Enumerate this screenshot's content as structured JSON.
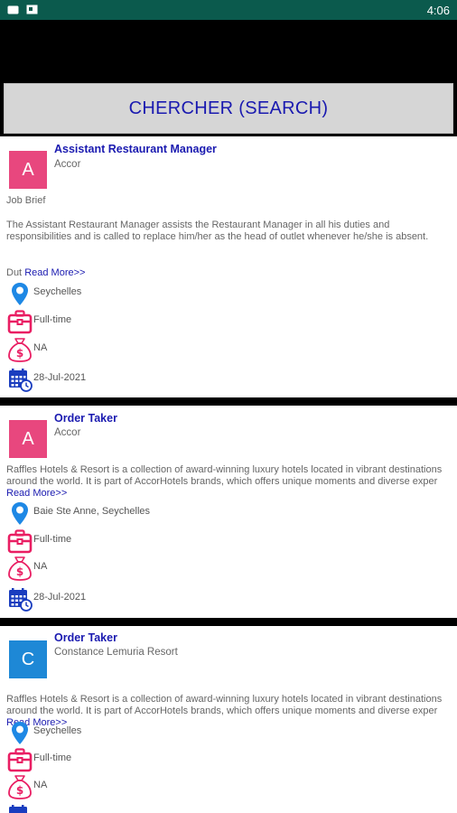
{
  "status_bar": {
    "time": "4:06"
  },
  "search": {
    "label": "CHERCHER (SEARCH)"
  },
  "colors": {
    "accent": "#1a1ab0",
    "status_bar": "#0b5a4d",
    "avatar_pink": "#e8477e",
    "avatar_blue": "#1e88d6",
    "location": "#1e88e5",
    "job_type": "#e91e63",
    "calendar": "#1a3dbf"
  },
  "jobs": [
    {
      "avatar_letter": "A",
      "title": "Assistant Restaurant Manager",
      "company": "Accor",
      "brief": "Job Brief",
      "description": "The Assistant Restaurant Manager assists the Restaurant Manager in all his duties and responsibilities and is called to replace him/her as the head of outlet whenever he/she is absent.",
      "description_tail": "Dut",
      "read_more": "Read More>>",
      "location": "Seychelles",
      "job_type": "Full-time",
      "salary": "NA",
      "date": "28-Jul-2021"
    },
    {
      "avatar_letter": "A",
      "title": "Order Taker",
      "company": "Accor",
      "description": "Raffles Hotels & Resort is a collection of award-winning luxury hotels located in vibrant destinations around the world. It is part of AccorHotels brands, which offers unique moments and diverse exper",
      "read_more": "Read More>>",
      "location": "Baie Ste Anne, Seychelles",
      "job_type": "Full-time",
      "salary": "NA",
      "date": "28-Jul-2021"
    },
    {
      "avatar_letter": "C",
      "title": "Order Taker",
      "company": "Constance Lemuria Resort",
      "description": "Raffles Hotels & Resort is a collection of award-winning luxury hotels located in vibrant destinations around the world. It is part of AccorHotels brands, which offers unique moments and diverse exper",
      "read_more": "Read More>>",
      "location": "Seychelles",
      "job_type": "Full-time",
      "salary": "NA"
    }
  ]
}
